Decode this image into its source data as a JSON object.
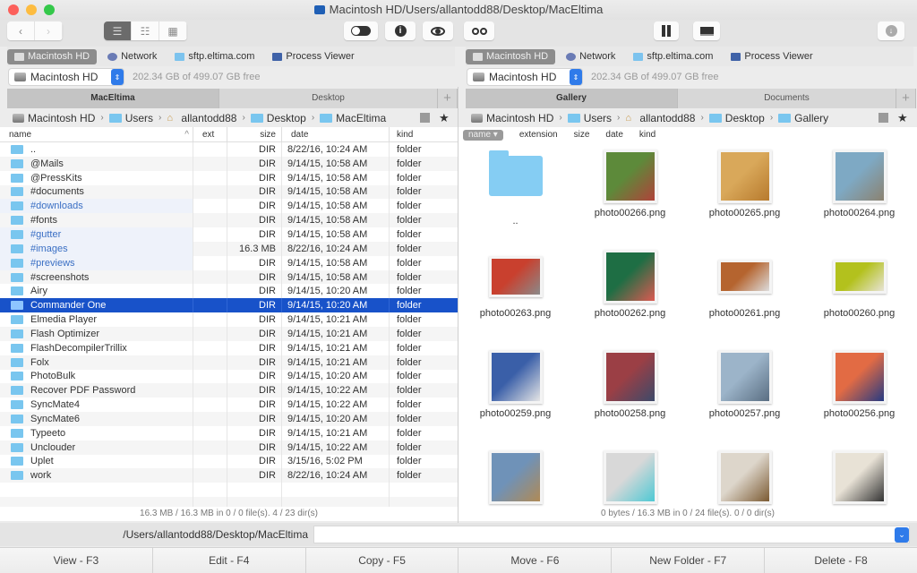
{
  "window": {
    "title": "Macintosh HD/Users/allantodd88/Desktop/MacEltima",
    "traffic_lights": {
      "close": "#fc605b",
      "minimize": "#fdbc40",
      "zoom": "#34c84a"
    }
  },
  "toolbar": {
    "back_icon": "‹",
    "forward_icon": "›",
    "view_modes": [
      "list-view-icon",
      "detail-view-icon",
      "thumbnail-view-icon"
    ],
    "view_glyphs": [
      "☰",
      "☷",
      "▦"
    ],
    "active_view": "list",
    "buttons": [
      {
        "name": "toggle-hidden-files",
        "glyph": "◐"
      },
      {
        "name": "info",
        "glyph": "ℹ"
      },
      {
        "name": "quick-look",
        "glyph": "◉"
      },
      {
        "name": "search-binoculars",
        "glyph": "⚭"
      },
      {
        "name": "compress-archive",
        "glyph": "▮▮"
      },
      {
        "name": "terminal-connect",
        "glyph": "▬"
      },
      {
        "name": "download-queue",
        "glyph": "⬇"
      }
    ]
  },
  "drives": [
    {
      "label": "Macintosh HD",
      "icon": "hard-drive-icon",
      "active": true,
      "color": "#ffffff"
    },
    {
      "label": "Network",
      "icon": "network-icon",
      "active": false,
      "color": "#6a7bb5"
    },
    {
      "label": "sftp.eltima.com",
      "icon": "sftp-icon",
      "active": false,
      "color": "#7cc3ee"
    },
    {
      "label": "Process Viewer",
      "icon": "process-viewer-icon",
      "active": false,
      "color": "#3f62a8"
    }
  ],
  "left": {
    "volume": "Macintosh HD",
    "free": "202.34 GB of 499.07 GB free",
    "tabs": [
      {
        "label": "MacEltima",
        "active": true
      },
      {
        "label": "Desktop",
        "active": false
      }
    ],
    "add_tab": "+",
    "breadcrumb": [
      "Macintosh HD",
      "Users",
      "allantodd88",
      "Desktop",
      "MacEltima"
    ],
    "columns": {
      "name": "name",
      "ext": "ext",
      "size": "size",
      "date": "date",
      "kind": "kind",
      "sort_icon": "^"
    },
    "rows": [
      {
        "name": "..",
        "size": "DIR",
        "date": "8/22/16, 10:24 AM",
        "kind": "folder",
        "tagged": false
      },
      {
        "name": "@Mails",
        "size": "DIR",
        "date": "9/14/15, 10:58 AM",
        "kind": "folder",
        "tagged": false
      },
      {
        "name": "@PressKits",
        "size": "DIR",
        "date": "9/14/15, 10:58 AM",
        "kind": "folder",
        "tagged": false
      },
      {
        "name": "#documents",
        "size": "DIR",
        "date": "9/14/15, 10:58 AM",
        "kind": "folder",
        "tagged": false
      },
      {
        "name": "#downloads",
        "size": "DIR",
        "date": "9/14/15, 10:58 AM",
        "kind": "folder",
        "tagged": true
      },
      {
        "name": "#fonts",
        "size": "DIR",
        "date": "9/14/15, 10:58 AM",
        "kind": "folder",
        "tagged": false
      },
      {
        "name": "#gutter",
        "size": "DIR",
        "date": "9/14/15, 10:58 AM",
        "kind": "folder",
        "tagged": true
      },
      {
        "name": "#images",
        "size": "16.3 MB",
        "date": "8/22/16, 10:24 AM",
        "kind": "folder",
        "tagged": true
      },
      {
        "name": "#previews",
        "size": "DIR",
        "date": "9/14/15, 10:58 AM",
        "kind": "folder",
        "tagged": true
      },
      {
        "name": "#screenshots",
        "size": "DIR",
        "date": "9/14/15, 10:58 AM",
        "kind": "folder",
        "tagged": false
      },
      {
        "name": "Airy",
        "size": "DIR",
        "date": "9/14/15, 10:20 AM",
        "kind": "folder",
        "tagged": false
      },
      {
        "name": "Commander One",
        "size": "DIR",
        "date": "9/14/15, 10:20 AM",
        "kind": "folder",
        "tagged": false,
        "selected": true
      },
      {
        "name": "Elmedia Player",
        "size": "DIR",
        "date": "9/14/15, 10:21 AM",
        "kind": "folder",
        "tagged": false
      },
      {
        "name": "Flash Optimizer",
        "size": "DIR",
        "date": "9/14/15, 10:21 AM",
        "kind": "folder",
        "tagged": false
      },
      {
        "name": "FlashDecompilerTrillix",
        "size": "DIR",
        "date": "9/14/15, 10:21 AM",
        "kind": "folder",
        "tagged": false
      },
      {
        "name": "Folx",
        "size": "DIR",
        "date": "9/14/15, 10:21 AM",
        "kind": "folder",
        "tagged": false
      },
      {
        "name": "PhotoBulk",
        "size": "DIR",
        "date": "9/14/15, 10:20 AM",
        "kind": "folder",
        "tagged": false
      },
      {
        "name": "Recover PDF Password",
        "size": "DIR",
        "date": "9/14/15, 10:22 AM",
        "kind": "folder",
        "tagged": false
      },
      {
        "name": "SyncMate4",
        "size": "DIR",
        "date": "9/14/15, 10:22 AM",
        "kind": "folder",
        "tagged": false
      },
      {
        "name": "SyncMate6",
        "size": "DIR",
        "date": "9/14/15, 10:20 AM",
        "kind": "folder",
        "tagged": false
      },
      {
        "name": "Typeeto",
        "size": "DIR",
        "date": "9/14/15, 10:21 AM",
        "kind": "folder",
        "tagged": false
      },
      {
        "name": "Unclouder",
        "size": "DIR",
        "date": "9/14/15, 10:22 AM",
        "kind": "folder",
        "tagged": false
      },
      {
        "name": "Uplet",
        "size": "DIR",
        "date": "3/15/16, 5:02 PM",
        "kind": "folder",
        "tagged": false
      },
      {
        "name": "work",
        "size": "DIR",
        "date": "8/22/16, 10:24 AM",
        "kind": "folder",
        "tagged": false
      }
    ],
    "status": "16.3 MB / 16.3 MB in 0 / 0 file(s). 4 / 23 dir(s)"
  },
  "right": {
    "volume": "Macintosh HD",
    "free": "202.34 GB of 499.07 GB free",
    "tabs": [
      {
        "label": "Gallery",
        "active": true
      },
      {
        "label": "Documents",
        "active": false
      }
    ],
    "add_tab": "+",
    "breadcrumb": [
      "Macintosh HD",
      "Users",
      "allantodd88",
      "Desktop",
      "Gallery"
    ],
    "sort_fields": [
      "name ▾",
      "extension",
      "size",
      "date",
      "kind"
    ],
    "active_sort": "name",
    "items": [
      {
        "name": "..",
        "type": "folder"
      },
      {
        "name": "photo00266.png",
        "colors": [
          "#5d8a3a",
          "#b0423a"
        ]
      },
      {
        "name": "photo00265.png",
        "colors": [
          "#d9a85a",
          "#b77a2d"
        ]
      },
      {
        "name": "photo00264.png",
        "colors": [
          "#7ea9c4",
          "#8b8270"
        ]
      },
      {
        "name": "photo00263.png",
        "colors": [
          "#c9402e",
          "#8a8a8a"
        ]
      },
      {
        "name": "photo00262.png",
        "colors": [
          "#1e6e44",
          "#dc5a52"
        ]
      },
      {
        "name": "photo00261.png",
        "colors": [
          "#b5642f",
          "#dcdcdc"
        ]
      },
      {
        "name": "photo00260.png",
        "colors": [
          "#b3c11d",
          "#e7e3d6"
        ]
      },
      {
        "name": "photo00259.png",
        "colors": [
          "#3a5fa8",
          "#e5e5e5"
        ]
      },
      {
        "name": "photo00258.png",
        "colors": [
          "#9b3f45",
          "#3c4a6a"
        ]
      },
      {
        "name": "photo00257.png",
        "colors": [
          "#9cb4c9",
          "#5a6e82"
        ]
      },
      {
        "name": "photo00256.png",
        "colors": [
          "#e26b44",
          "#253a83"
        ]
      },
      {
        "name": "",
        "colors": [
          "#6f92b8",
          "#b08a55"
        ]
      },
      {
        "name": "",
        "colors": [
          "#d8d8d8",
          "#4ec9d4"
        ]
      },
      {
        "name": "",
        "colors": [
          "#ddd6cb",
          "#7b5a32"
        ]
      },
      {
        "name": "",
        "colors": [
          "#e8e2d6",
          "#333333"
        ]
      }
    ],
    "status": "0 bytes / 16.3 MB in 0 / 24 file(s). 0 / 0 dir(s)"
  },
  "command_line": {
    "path": "/Users/allantodd88/Desktop/MacEltima",
    "value": "",
    "dropdown_icon": "⌄"
  },
  "function_keys": [
    "View - F3",
    "Edit - F4",
    "Copy - F5",
    "Move - F6",
    "New Folder - F7",
    "Delete - F8"
  ],
  "colors": {
    "selection": "#1852c9",
    "accent": "#2f7bea",
    "folder": "#79c6ef",
    "tag_text": "#3a6fc4"
  }
}
